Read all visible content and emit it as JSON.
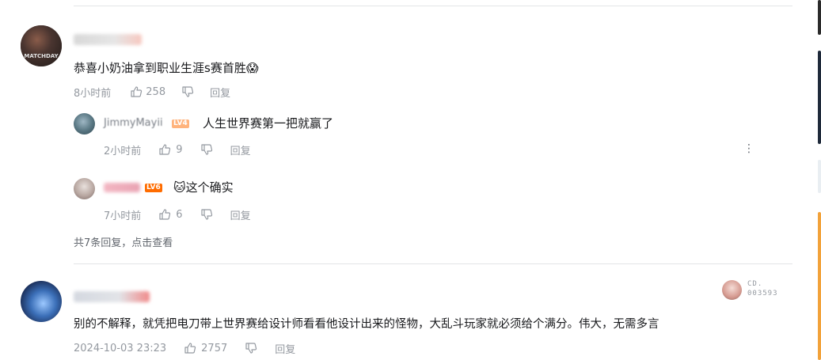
{
  "comments": [
    {
      "text": "恭喜小奶油拿到职业生涯s赛首胜",
      "emoji": "😱",
      "time": "8小时前",
      "likes": "258",
      "reply_label": "回复",
      "avatar_text": "MATCHDAY"
    },
    {
      "text": "别的不解释，就凭把电刀带上世界赛给设计师看看他设计出来的怪物，大乱斗玩家就必须给个满分。伟大，无需多言",
      "time": "2024-10-03 23:23",
      "likes": "2757",
      "reply_label": "回复",
      "badge_line1": "CD.",
      "badge_line2": "003593"
    }
  ],
  "replies": [
    {
      "name": "JimmyMayii",
      "level": "LV4",
      "text": "人生世界赛第一把就赢了",
      "time": "2小时前",
      "likes": "9",
      "reply_label": "回复",
      "more": "⋮"
    },
    {
      "level": "LV6",
      "emoji": "🐱",
      "text": "这个确实",
      "time": "7小时前",
      "likes": "6",
      "reply_label": "回复"
    }
  ],
  "view_more": "共7条回复，点击查看",
  "colors": {
    "lv4": "#ffb37c",
    "lv6": "#ff6c00",
    "meta": "#9499a0",
    "divider": "#e3e5e7"
  }
}
